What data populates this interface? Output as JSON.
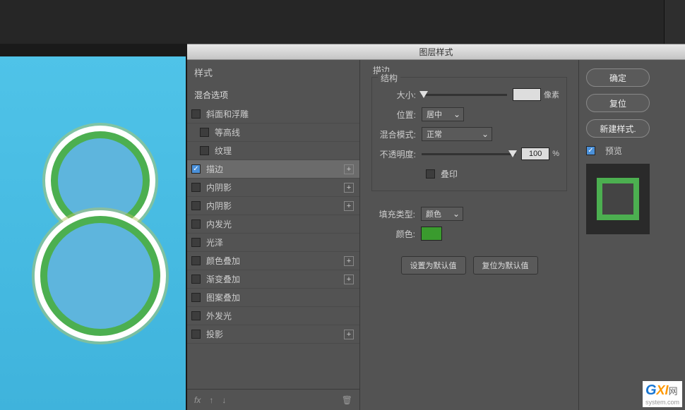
{
  "dialog": {
    "title": "图层样式"
  },
  "styles_panel": {
    "header": "样式",
    "blend_options": "混合选项",
    "items": [
      {
        "label": "斜面和浮雕",
        "checked": false,
        "indent": false,
        "addable": false
      },
      {
        "label": "等高线",
        "checked": false,
        "indent": true,
        "addable": false
      },
      {
        "label": "纹理",
        "checked": false,
        "indent": true,
        "addable": false
      },
      {
        "label": "描边",
        "checked": true,
        "indent": false,
        "addable": true,
        "selected": true
      },
      {
        "label": "内阴影",
        "checked": false,
        "indent": false,
        "addable": true
      },
      {
        "label": "内阴影",
        "checked": false,
        "indent": false,
        "addable": true
      },
      {
        "label": "内发光",
        "checked": false,
        "indent": false,
        "addable": false
      },
      {
        "label": "光泽",
        "checked": false,
        "indent": false,
        "addable": false
      },
      {
        "label": "颜色叠加",
        "checked": false,
        "indent": false,
        "addable": true
      },
      {
        "label": "渐变叠加",
        "checked": false,
        "indent": false,
        "addable": true
      },
      {
        "label": "图案叠加",
        "checked": false,
        "indent": false,
        "addable": false
      },
      {
        "label": "外发光",
        "checked": false,
        "indent": false,
        "addable": false
      },
      {
        "label": "投影",
        "checked": false,
        "indent": false,
        "addable": true
      }
    ],
    "footer_fx": "fx"
  },
  "settings": {
    "section_title": "描边",
    "structure_title": "结构",
    "size_label": "大小:",
    "size_value": "",
    "size_unit": "像素",
    "position_label": "位置:",
    "position_value": "居中",
    "blend_label": "混合模式:",
    "blend_value": "正常",
    "opacity_label": "不透明度:",
    "opacity_value": "100",
    "opacity_unit": "%",
    "overprint_label": "叠印",
    "fill_type_label": "填充类型:",
    "fill_type_value": "颜色",
    "color_label": "颜色:",
    "color_value": "#3a9b2e",
    "btn_default": "设置为默认值",
    "btn_reset": "复位为默认值"
  },
  "right": {
    "ok": "确定",
    "cancel": "复位",
    "new_style": "新建样式.",
    "preview": "预览"
  },
  "watermark": {
    "g": "G",
    "xi": "XI",
    "text": "网",
    "sub": "system.com"
  }
}
